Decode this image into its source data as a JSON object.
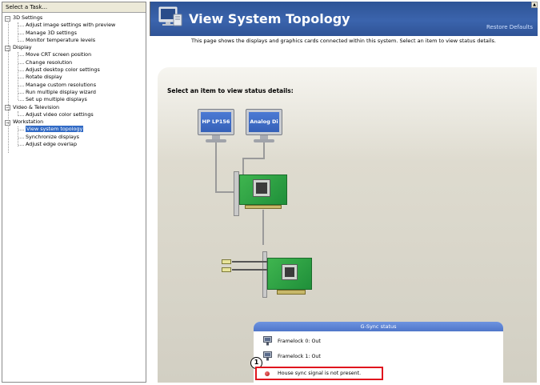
{
  "left_panel": {
    "header": "Select a Task...",
    "tree": [
      {
        "category": "3D Settings",
        "items": [
          "Adjust image settings with preview",
          "Manage 3D settings",
          "Monitor temperature levels"
        ]
      },
      {
        "category": "Display",
        "items": [
          "Move CRT screen position",
          "Change resolution",
          "Adjust desktop color settings",
          "Rotate display",
          "Manage custom resolutions",
          "Run multiple display wizard",
          "Set up multiple displays"
        ]
      },
      {
        "category": "Video & Television",
        "items": [
          "Adjust video color settings"
        ]
      },
      {
        "category": "Workstation",
        "items": [
          "View system topology",
          "Synchronize displays",
          "Adjust edge overlap"
        ]
      }
    ],
    "selected_item": "View system topology"
  },
  "header": {
    "title": "View System Topology",
    "restore_link": "Restore Defaults",
    "description": "This page shows the displays and graphics cards connected within this system. Select an item to view status details."
  },
  "topology": {
    "select_label": "Select an item to view status details:",
    "monitors": [
      {
        "label": "HP LP156"
      },
      {
        "label": "Analog Di"
      }
    ]
  },
  "gsync": {
    "title": "G-Sync status",
    "framelocks": [
      {
        "label": "Framelock 0: Out"
      },
      {
        "label": "Framelock 1: Out"
      }
    ],
    "alert_text": "House sync signal is not present.",
    "callout_number": "1"
  },
  "colors": {
    "title_bar": "#3b64ad",
    "selected_bg": "#316ac5",
    "alert_border": "#e0161e",
    "gsync_header": "#5b82d4",
    "pcb_green": "#2fa546"
  },
  "icons": [
    "monitor-topology-icon",
    "toggle-minus-icon",
    "framelock-icon",
    "red-status-dot-icon"
  ]
}
